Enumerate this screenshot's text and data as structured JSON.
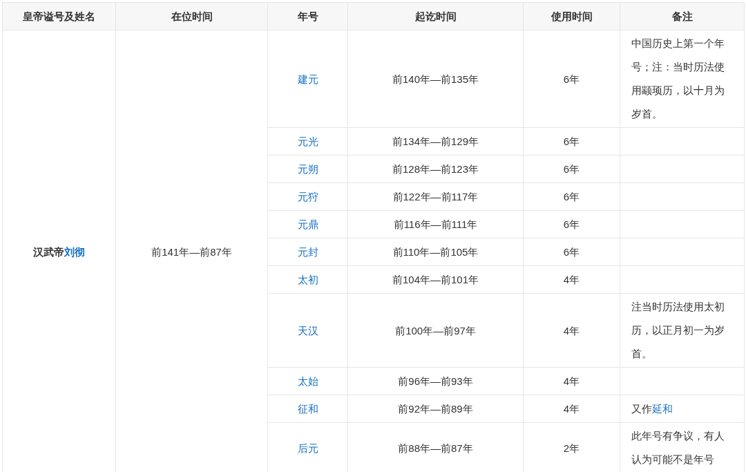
{
  "table": {
    "columns": [
      "皇帝谥号及姓名",
      "在位时间",
      "年号",
      "起讫时间",
      "使用时间",
      "备注"
    ],
    "emperor": {
      "title": "汉武帝",
      "name_link": "刘彻"
    },
    "reign": "前141年—前87年",
    "rows": [
      {
        "era": "建元",
        "range": "前140年—前135年",
        "duration": "6年",
        "note": "中国历史上第一个年号；注：当时历法使用颛顼历，以十月为岁首。"
      },
      {
        "era": "元光",
        "range": "前134年—前129年",
        "duration": "6年"
      },
      {
        "era": "元朔",
        "range": "前128年—前123年",
        "duration": "6年"
      },
      {
        "era": "元狩",
        "range": "前122年—前117年",
        "duration": "6年"
      },
      {
        "era": "元鼎",
        "range": "前116年—前111年",
        "duration": "6年"
      },
      {
        "era": "元封",
        "range": "前110年—前105年",
        "duration": "6年"
      },
      {
        "era": "太初",
        "range": "前104年—前101年",
        "duration": "4年"
      },
      {
        "era": "天汉",
        "range": "前100年—前97年",
        "duration": "4年",
        "note": "注当时历法使用太初历，以正月初一为岁首。"
      },
      {
        "era": "太始",
        "range": "前96年—前93年",
        "duration": "4年"
      },
      {
        "era": "征和",
        "range": "前92年—前89年",
        "duration": "4年",
        "note": "又作",
        "note_link": "延和"
      },
      {
        "era": "后元",
        "range": "前88年—前87年",
        "duration": "2年",
        "note": "此年号有争议，有人认为可能不是年号"
      }
    ]
  }
}
